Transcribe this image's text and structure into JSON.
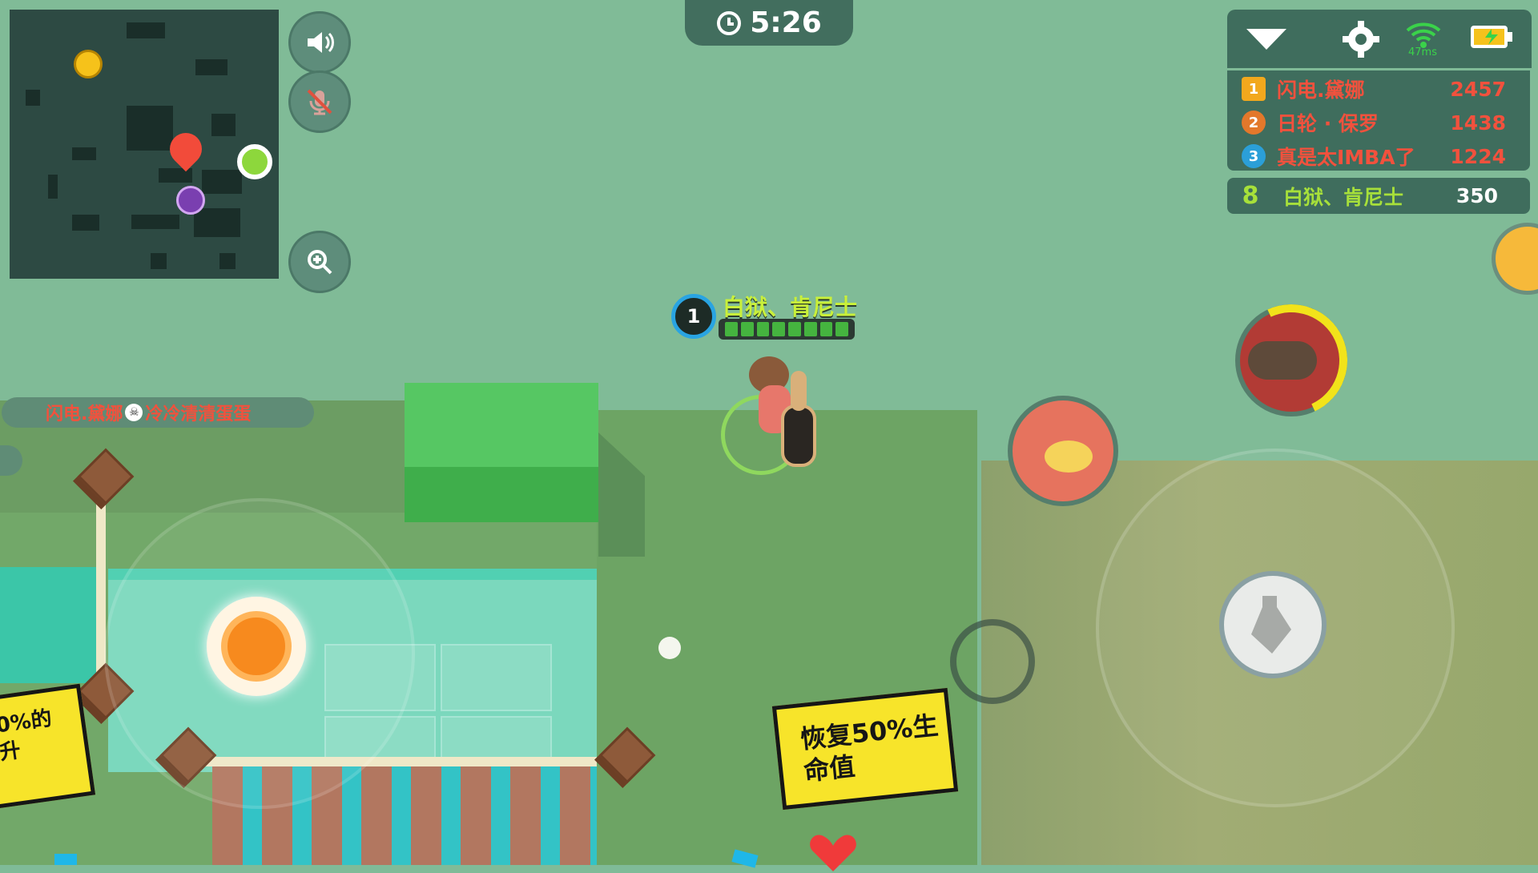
{
  "timer": {
    "value": "5:26",
    "icon": "clock-icon"
  },
  "status": {
    "ping": "47ms",
    "icons": [
      "dropdown-icon",
      "gear-icon",
      "wifi-icon",
      "battery-icon"
    ]
  },
  "leaderboard": [
    {
      "rank": "1",
      "name": "闪电.黛娜",
      "score": "2457"
    },
    {
      "rank": "2",
      "name": "日轮 · 保罗",
      "score": "1438"
    },
    {
      "rank": "3",
      "name": "真是太IMBA了",
      "score": "1224"
    }
  ],
  "my_rank": {
    "rank": "8",
    "name": "白狱、肯尼士",
    "score": "350"
  },
  "killfeed": {
    "killer": "闪电.黛娜",
    "victim": "冷冷清清蛋蛋"
  },
  "player": {
    "name": "白狱、肯尼士",
    "level": "1",
    "hp_segments": 8
  },
  "bubbles": {
    "heal": "恢复50%生命值",
    "left_partial": "0%的\n升"
  },
  "colors": {
    "enemy_name": "#f2513d",
    "self_name": "#a7e03a",
    "hp": "#45b43f"
  }
}
